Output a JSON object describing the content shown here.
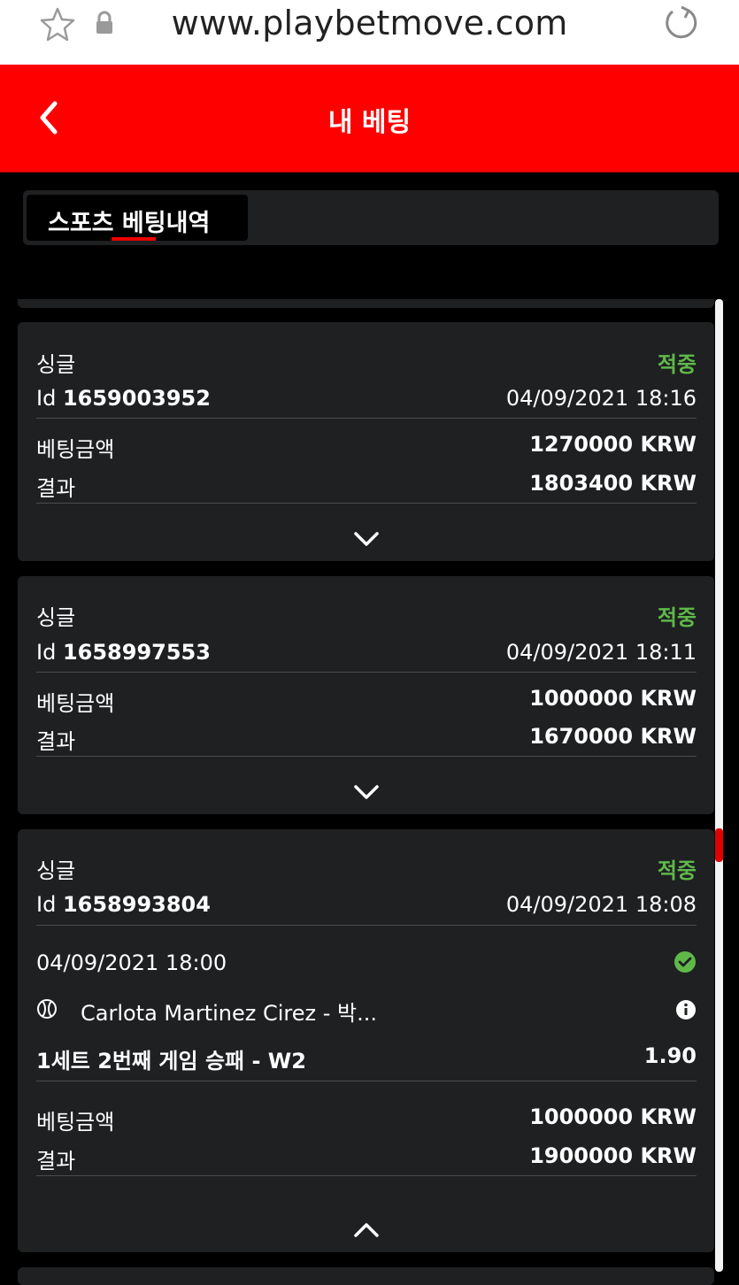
{
  "browser": {
    "url": "www.playbetmove.com",
    "icons": [
      "star-icon",
      "lock-icon",
      "reload-icon"
    ]
  },
  "header": {
    "title": "내 베팅",
    "back_icon": "chevron-left-icon"
  },
  "tabs": {
    "active_label": "스포츠 베팅내역"
  },
  "colors": {
    "header_bg": "#ff0000",
    "page_bg": "#000000",
    "card_bg": "#1e2022",
    "win_green": "#5fb84a",
    "accent_red": "#e00000"
  },
  "bets": [
    {
      "type": "싱글",
      "status": "적중",
      "id_label": "Id",
      "id": "1659003952",
      "datetime": "04/09/2021 18:16",
      "stake_label": "베팅금액",
      "stake": "1270000 KRW",
      "result_label": "결과",
      "result": "1803400 KRW",
      "expanded": false
    },
    {
      "type": "싱글",
      "status": "적중",
      "id_label": "Id",
      "id": "1658997553",
      "datetime": "04/09/2021 18:11",
      "stake_label": "베팅금액",
      "stake": "1000000 KRW",
      "result_label": "결과",
      "result": "1670000 KRW",
      "expanded": false
    },
    {
      "type": "싱글",
      "status": "적중",
      "id_label": "Id",
      "id": "1658993804",
      "datetime": "04/09/2021 18:08",
      "event": {
        "datetime": "04/09/2021 18:00",
        "sport_icon": "tennis-ball-icon",
        "match": "Carlota Martinez Cirez - 박...",
        "market": "1세트 2번째 게임 승패 - W2",
        "odds": "1.90"
      },
      "stake_label": "베팅금액",
      "stake": "1000000 KRW",
      "result_label": "결과",
      "result": "1900000 KRW",
      "expanded": true
    }
  ]
}
